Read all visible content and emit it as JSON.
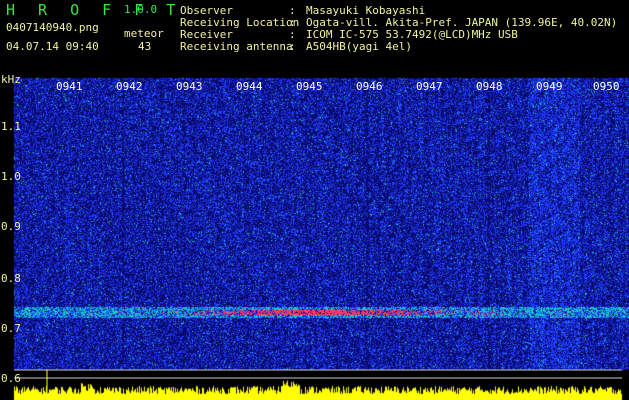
{
  "header": {
    "app_title": "H R O F F T",
    "app_version": "1.0.0",
    "file_name": "0407140940.png",
    "datetime": "04.07.14 09:40",
    "meteor_label": "meteor",
    "meteor_count": "43",
    "info": [
      {
        "label": "Observer",
        "value": "Masayuki Kobayashi"
      },
      {
        "label": "Receiving Location",
        "value": "Ogata-vill. Akita-Pref. JAPAN (139.96E, 40.02N)"
      },
      {
        "label": "Receiver",
        "value": "ICOM IC-575 53.7492(@LCD)MHz USB"
      },
      {
        "label": "Receiving antenna",
        "value": "A504HB(yagi 4el)"
      }
    ],
    "separator": ":"
  },
  "spectrogram": {
    "axis_unit": "kHz",
    "y_ticks": [
      "1.1",
      "1.0",
      "0.9",
      "0.8",
      "0.7",
      "0.6"
    ],
    "time_ticks": [
      "0941",
      "0942",
      "0943",
      "0944",
      "0945",
      "0946",
      "0947",
      "0948",
      "0949",
      "0950"
    ],
    "colors": {
      "background": "#0a0a6e",
      "noise": "#1e3cff",
      "signal": "#18c8c8",
      "peak": "#ff3a5a",
      "bar": "#ffff00",
      "text": "#f2f2a0"
    }
  }
}
